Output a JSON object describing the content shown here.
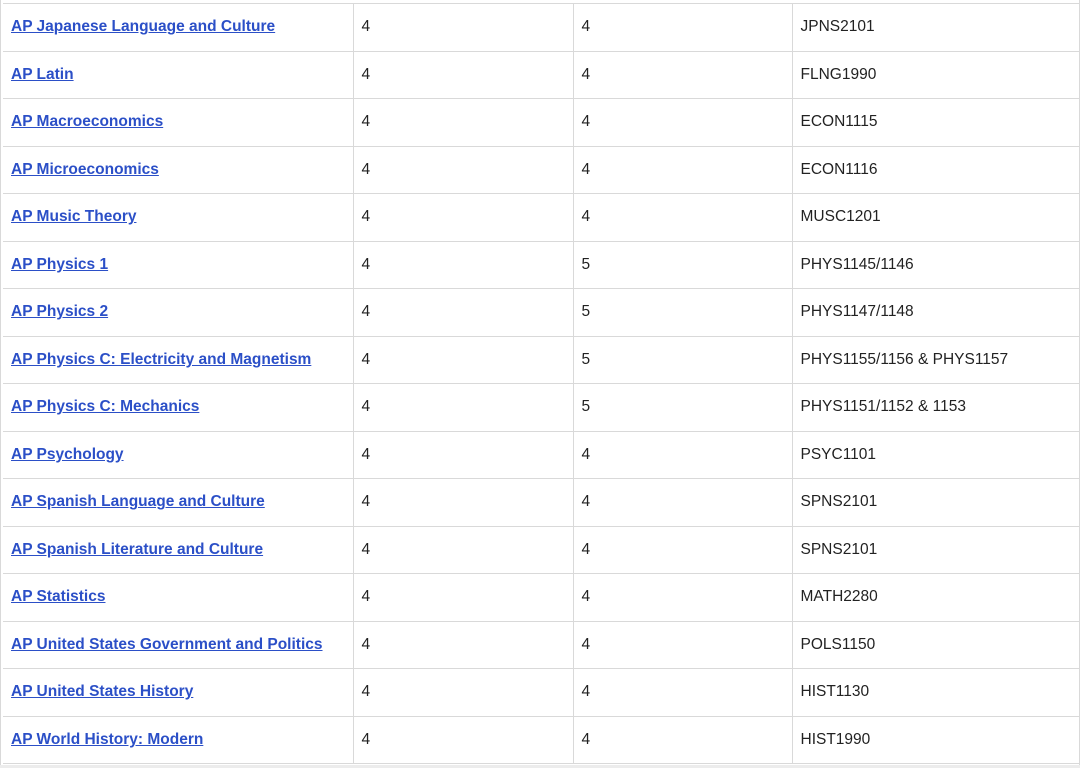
{
  "rows": [
    {
      "course": "AP Japanese Language and Culture",
      "score": "4",
      "credits": "4",
      "equivalent": "JPNS2101"
    },
    {
      "course": "AP Latin",
      "score": "4",
      "credits": "4",
      "equivalent": "FLNG1990"
    },
    {
      "course": "AP Macroeconomics",
      "score": "4",
      "credits": "4",
      "equivalent": "ECON1115"
    },
    {
      "course": "AP Microeconomics",
      "score": "4",
      "credits": "4",
      "equivalent": "ECON1116"
    },
    {
      "course": "AP Music Theory",
      "score": "4",
      "credits": "4",
      "equivalent": "MUSC1201"
    },
    {
      "course": "AP Physics 1",
      "score": "4",
      "credits": "5",
      "equivalent": "PHYS1145/1146"
    },
    {
      "course": "AP Physics 2",
      "score": "4",
      "credits": "5",
      "equivalent": "PHYS1147/1148"
    },
    {
      "course": "AP Physics C: Electricity and Magnetism",
      "score": "4",
      "credits": "5",
      "equivalent": "PHYS1155/1156 & PHYS1157"
    },
    {
      "course": "AP Physics C: Mechanics",
      "score": "4",
      "credits": "5",
      "equivalent": "PHYS1151/1152 & 1153"
    },
    {
      "course": "AP Psychology",
      "score": "4",
      "credits": "4",
      "equivalent": "PSYC1101"
    },
    {
      "course": "AP Spanish Language and Culture",
      "score": "4",
      "credits": "4",
      "equivalent": "SPNS2101"
    },
    {
      "course": "AP Spanish Literature and Culture",
      "score": "4",
      "credits": "4",
      "equivalent": "SPNS2101"
    },
    {
      "course": "AP Statistics",
      "score": "4",
      "credits": "4",
      "equivalent": "MATH2280"
    },
    {
      "course": "AP United States Government and Politics",
      "score": "4",
      "credits": "4",
      "equivalent": "POLS1150"
    },
    {
      "course": "AP United States History",
      "score": "4",
      "credits": "4",
      "equivalent": "HIST1130"
    },
    {
      "course": "AP World History: Modern",
      "score": "4",
      "credits": "4",
      "equivalent": "HIST1990"
    }
  ],
  "colors": {
    "link": "#2b4fc7",
    "border": "#d9d9d9",
    "text": "#222222"
  }
}
